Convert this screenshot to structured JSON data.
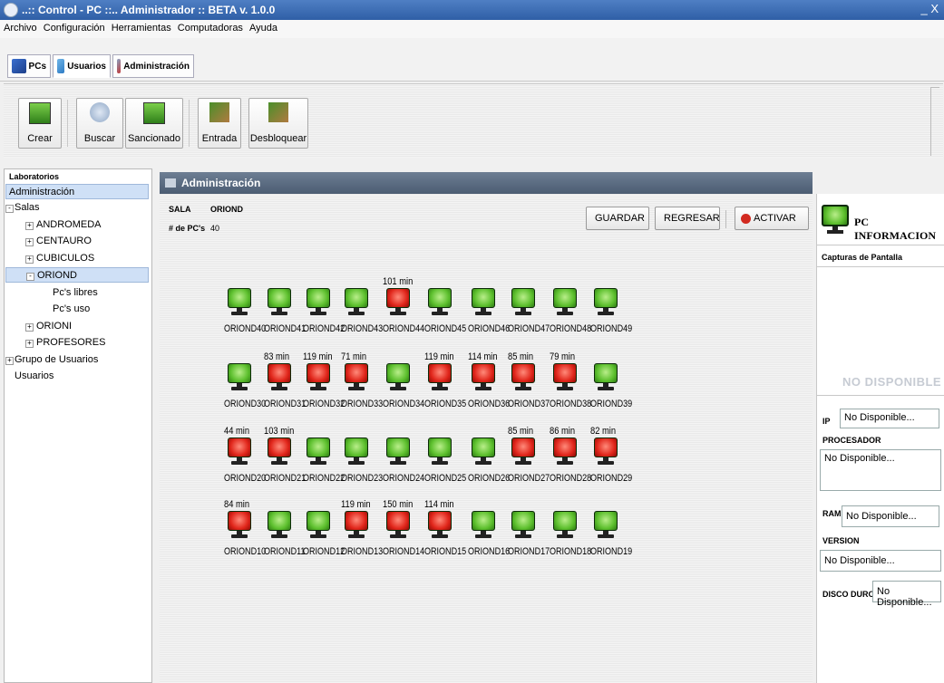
{
  "window": {
    "title": "..:: Control - PC ::.. Administrador :: BETA v. 1.0.0",
    "close": "_ X"
  },
  "menu": [
    "Archivo",
    "Configuración",
    "Herramientas",
    "Computadoras",
    "Ayuda"
  ],
  "tabs": [
    {
      "label": "PCs",
      "icon": "pcs-icon"
    },
    {
      "label": "Usuarios",
      "icon": "users-icon"
    },
    {
      "label": "Administración",
      "icon": "admin-icon"
    }
  ],
  "toolbar": {
    "buttons": [
      {
        "label": "Crear",
        "icon": "create-icon"
      },
      {
        "label": "Buscar",
        "icon": "search-icon"
      },
      {
        "label": "Sancionado",
        "icon": "sanctioned-icon"
      },
      {
        "label": "Entrada",
        "icon": "entry-icon"
      },
      {
        "label": "Desbloquear",
        "icon": "unlock-icon"
      }
    ]
  },
  "left": {
    "legend": "Laboratorios",
    "items": [
      {
        "label": "Administración"
      },
      {
        "label": "Salas"
      },
      {
        "label": "ANDROMEDA"
      },
      {
        "label": "CENTAURO"
      },
      {
        "label": "CUBICULOS"
      },
      {
        "label": "ORIOND"
      },
      {
        "label": "Pc's libres"
      },
      {
        "label": "Pc's uso"
      },
      {
        "label": "ORIONI"
      },
      {
        "label": "PROFESORES"
      },
      {
        "label": "Grupo de Usuarios"
      },
      {
        "label": "Usuarios"
      }
    ]
  },
  "main": {
    "title": "Administración",
    "sala_label": "SALA",
    "sala_value": "ORIOND",
    "pcs_label": "# de PC's",
    "pcs_value": "40",
    "buttons": {
      "save": "GUARDAR",
      "back": "REGRESAR",
      "activate": "ACTIVAR"
    },
    "pcs": [
      {
        "name": "ORIOND40",
        "status": "libre",
        "time": ""
      },
      {
        "name": "ORIOND41",
        "status": "libre",
        "time": ""
      },
      {
        "name": "ORIOND42",
        "status": "libre",
        "time": ""
      },
      {
        "name": "ORIOND43",
        "status": "libre",
        "time": ""
      },
      {
        "name": "ORIOND44",
        "status": "uso",
        "time": "101 min"
      },
      {
        "name": "ORIOND45",
        "status": "libre",
        "time": ""
      },
      {
        "name": "ORIOND46",
        "status": "libre",
        "time": ""
      },
      {
        "name": "ORIOND47",
        "status": "libre",
        "time": ""
      },
      {
        "name": "ORIOND48",
        "status": "libre",
        "time": ""
      },
      {
        "name": "ORIOND49",
        "status": "libre",
        "time": ""
      },
      {
        "name": "ORIOND30",
        "status": "libre",
        "time": ""
      },
      {
        "name": "ORIOND31",
        "status": "uso",
        "time": "83 min"
      },
      {
        "name": "ORIOND32",
        "status": "uso",
        "time": "119 min"
      },
      {
        "name": "ORIOND33",
        "status": "uso",
        "time": "71 min"
      },
      {
        "name": "ORIOND34",
        "status": "libre",
        "time": ""
      },
      {
        "name": "ORIOND35",
        "status": "uso",
        "time": "119 min"
      },
      {
        "name": "ORIOND36",
        "status": "uso",
        "time": "114 min"
      },
      {
        "name": "ORIOND37",
        "status": "uso",
        "time": "85 min"
      },
      {
        "name": "ORIOND38",
        "status": "uso",
        "time": "79 min"
      },
      {
        "name": "ORIOND39",
        "status": "libre",
        "time": ""
      },
      {
        "name": "ORIOND20",
        "status": "uso",
        "time": "44 min"
      },
      {
        "name": "ORIOND21",
        "status": "uso",
        "time": "103 min"
      },
      {
        "name": "ORIOND22",
        "status": "libre",
        "time": ""
      },
      {
        "name": "ORIOND23",
        "status": "libre",
        "time": ""
      },
      {
        "name": "ORIOND24",
        "status": "libre",
        "time": ""
      },
      {
        "name": "ORIOND25",
        "status": "libre",
        "time": ""
      },
      {
        "name": "ORIOND26",
        "status": "libre",
        "time": ""
      },
      {
        "name": "ORIOND27",
        "status": "uso",
        "time": "85 min"
      },
      {
        "name": "ORIOND28",
        "status": "uso",
        "time": "86 min"
      },
      {
        "name": "ORIOND29",
        "status": "uso",
        "time": "82 min"
      },
      {
        "name": "ORIOND10",
        "status": "uso",
        "time": "84 min"
      },
      {
        "name": "ORIOND11",
        "status": "libre",
        "time": ""
      },
      {
        "name": "ORIOND12",
        "status": "libre",
        "time": ""
      },
      {
        "name": "ORIOND13",
        "status": "uso",
        "time": "119 min"
      },
      {
        "name": "ORIOND14",
        "status": "uso",
        "time": "150 min"
      },
      {
        "name": "ORIOND15",
        "status": "uso",
        "time": "114 min"
      },
      {
        "name": "ORIOND16",
        "status": "libre",
        "time": ""
      },
      {
        "name": "ORIOND17",
        "status": "libre",
        "time": ""
      },
      {
        "name": "ORIOND18",
        "status": "libre",
        "time": ""
      },
      {
        "name": "ORIOND19",
        "status": "libre",
        "time": ""
      }
    ]
  },
  "right": {
    "title": "PC INFORMACION",
    "captures_label": "Capturas de Pantalla",
    "no_disponible": "NO DISPONIBLE",
    "ip_label": "IP",
    "ip_value": "No Disponible...",
    "procesador_label": "PROCESADOR",
    "procesador_value": "No Disponible...",
    "ram_label": "RAM",
    "ram_value": "No Disponible...",
    "version_label": "VERSION",
    "version_value": "No Disponible...",
    "disco_label": "DISCO DURO",
    "disco_value": "No Disponible..."
  },
  "colors": {
    "free": "#5cbf2d",
    "busy": "#e0251a",
    "header": "#4b5c72",
    "selection": "#cfe0f6"
  }
}
